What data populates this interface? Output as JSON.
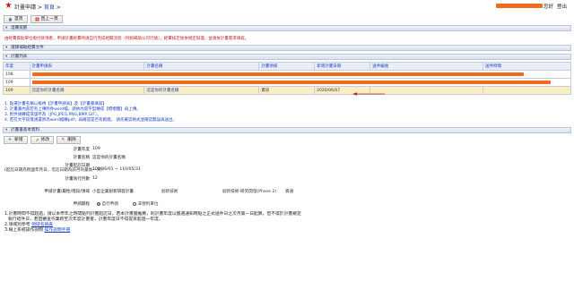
{
  "header": {
    "app_title": "計畫申請",
    "separator": " > ",
    "home_link": "首頁",
    "home_suffix": " >",
    "user_suffix": "您好",
    "logout_label": "登出"
  },
  "toolbar": {
    "home_label": "首頁",
    "back_label": "回上一頁"
  },
  "notice": {
    "title": "溫馨提醒",
    "text": "由經費資助單位撥付款項者，申請計畫經費時請自行完成相關流程（例如補助公司行號），經費核定後依規定辦理，並請依計畫需求填寫。"
  },
  "section_select": {
    "title": "選擇補助經費文件"
  },
  "section_list": {
    "title": "計畫列表"
  },
  "table": {
    "headers": [
      "年度",
      "計畫申請表",
      "",
      "計畫名稱",
      "計畫領域",
      "新增計畫日期",
      "送件編號",
      "送件時間"
    ],
    "rows": [
      {
        "year": "108",
        "type": "",
        "name": "",
        "domain": "",
        "date": "",
        "no": "",
        "time": "",
        "redacted": true
      },
      {
        "year": "109",
        "type": "",
        "name": "",
        "domain": "",
        "date": "",
        "no": "",
        "time": "",
        "redacted": true
      },
      {
        "year": "109",
        "type": "這是你的計畫名稱",
        "name": "這是你的計畫名稱",
        "domain": "資訊",
        "date": "2020/06/07",
        "no": "",
        "time": "",
        "redacted": false
      }
    ]
  },
  "tips": [
    "1. 點選計畫名稱以檢視【計畫申請表】及【計畫書填寫】",
    "2. 計畫書內容若有上傳附件word檔，請依內容字型轉成【標楷體】再上傳。",
    "3. 附件請轉成或儲存為（JPG,JPEG,PNG,BMP,GIF）。",
    "4. 若在文字段落請還原為word檔轉pdf，再確認是否有跑版。 請先確認格式並確認無誤再送出。"
  ],
  "section_basic": {
    "title": "計畫書基本資料"
  },
  "actions": {
    "add_label": "新增",
    "edit_label": "修改",
    "delete_label": "刪除"
  },
  "form": {
    "year_label": "計畫年度",
    "year_value": "109",
    "name_label": "計畫名稱",
    "name_value": "這是你的計畫名稱",
    "period_label": "計畫起訖日期",
    "period_value": "109/06/01 ~ 110/05/31",
    "period_hint": "(起訖日期為民國年月日，迄訖日期為該月的最後一天)",
    "months_label": "計畫執行月數",
    "months_value": "12",
    "category_label": "申請計畫/屬性/階段/領域",
    "category_value": "小型企業創新研發計畫",
    "category_attr": "創新技術",
    "category_stage": "創新技術-研究開發(Phase 2)",
    "category_domain": "資通",
    "sync_label": "申請期程",
    "sync_opt1": "自行申請",
    "sync_opt2": "非營利單位"
  },
  "footer": {
    "line1": "1.計畫時間不得超過，請以本學年之時間點列計畫起訖日，若本計畫獲推薦，則計畫年度以獲選通知時點之正式送件日之次月第一日起算，但不得於計畫規定",
    "line1b": "執行結件日，若因審查作業跨至次年度計畫者，計畫年度日不得提早超過一年度。",
    "line2_prefix": "2.領域別參考 ",
    "line2_link": "領域名稱表",
    "line3_prefix": "3.線上系統操作說明 ",
    "line3_link": "操作說明手冊"
  },
  "colors": {
    "accent_blue": "#1a3fd0",
    "redaction_orange": "#f06a1c",
    "alert_red": "#c62020",
    "selected_row": "#fbeec4"
  }
}
